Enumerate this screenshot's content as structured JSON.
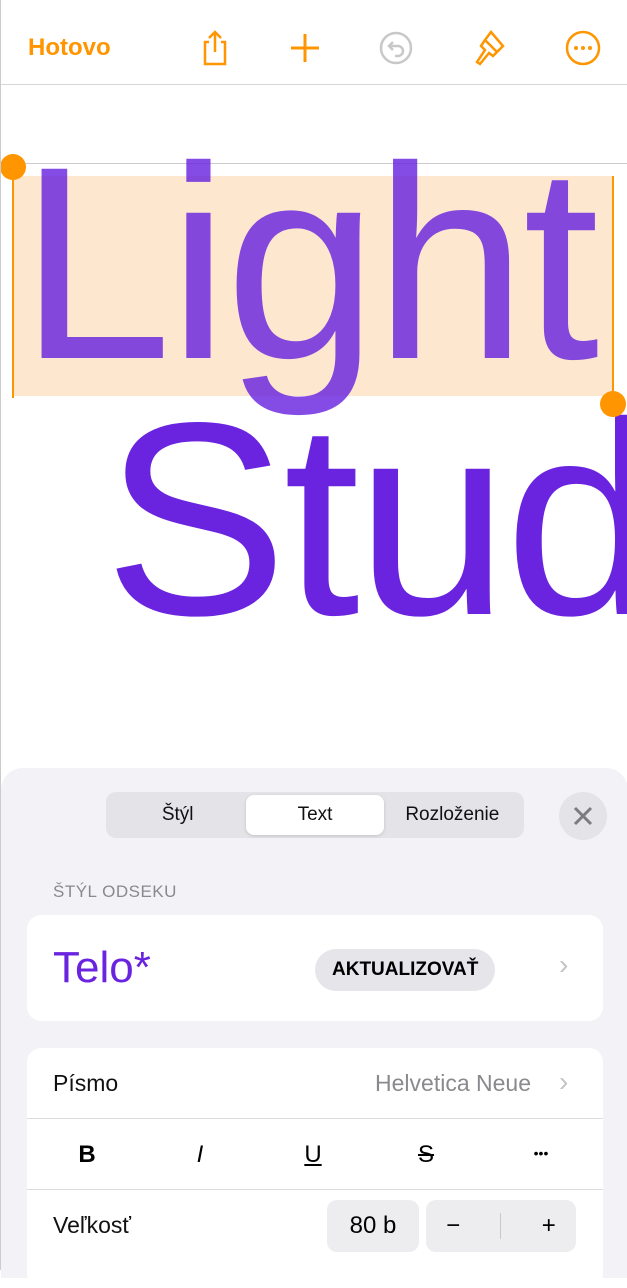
{
  "toolbar": {
    "done_label": "Hotovo",
    "icons": [
      "share-icon",
      "plus-icon",
      "undo-icon",
      "paintbrush-icon",
      "more-icon"
    ],
    "accent": "#ff9500"
  },
  "canvas": {
    "line1": "Light",
    "line2": "Stud",
    "text_color": "#6a24e0"
  },
  "panel": {
    "tabs": [
      {
        "label": "Štýl"
      },
      {
        "label": "Text",
        "active": true
      },
      {
        "label": "Rozloženie"
      }
    ],
    "section_header": "ŠTÝL ODSEKU",
    "paragraph_style": "Telo*",
    "update_label": "AKTUALIZOVAŤ",
    "font_label": "Písmo",
    "font_value": "Helvetica Neue",
    "format_buttons": [
      "B",
      "I",
      "U",
      "S",
      "•••"
    ],
    "size_label": "Veľkosť",
    "size_value": "80 b",
    "decrease": "−",
    "increase": "+"
  }
}
